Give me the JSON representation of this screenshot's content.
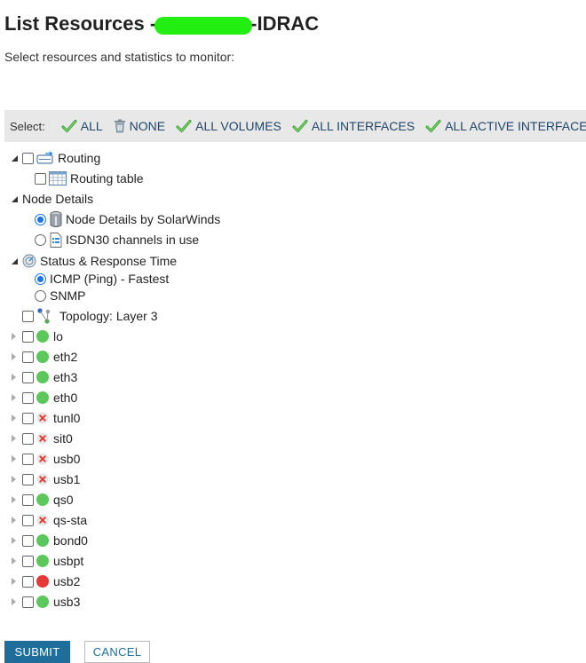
{
  "header": {
    "title_prefix": "List Resources -",
    "title_suffix": "-IDRAC",
    "subtitle": "Select resources and statistics to monitor:"
  },
  "select_bar": {
    "label": "Select:",
    "all": "ALL",
    "none": "NONE",
    "all_volumes": "ALL VOLUMES",
    "all_interfaces": "ALL INTERFACES",
    "all_active_interfaces": "ALL ACTIVE INTERFACES"
  },
  "tree": {
    "routing": "Routing",
    "routing_table": "Routing table",
    "node_details": "Node Details",
    "node_details_solarwinds": "Node Details by SolarWinds",
    "isdn30": "ISDN30 channels in use",
    "status_response": "Status & Response Time",
    "icmp": "ICMP (Ping) - Fastest",
    "snmp": "SNMP",
    "topology": "Topology: Layer 3"
  },
  "interfaces": [
    {
      "name": "lo",
      "status": "up"
    },
    {
      "name": "eth2",
      "status": "up"
    },
    {
      "name": "eth3",
      "status": "up"
    },
    {
      "name": "eth0",
      "status": "up"
    },
    {
      "name": "tunl0",
      "status": "unknown"
    },
    {
      "name": "sit0",
      "status": "unknown"
    },
    {
      "name": "usb0",
      "status": "unknown"
    },
    {
      "name": "usb1",
      "status": "unknown"
    },
    {
      "name": "qs0",
      "status": "up"
    },
    {
      "name": "qs-sta",
      "status": "unknown"
    },
    {
      "name": "bond0",
      "status": "up"
    },
    {
      "name": "usbpt",
      "status": "up"
    },
    {
      "name": "usb2",
      "status": "down"
    },
    {
      "name": "usb3",
      "status": "up"
    }
  ],
  "colors": {
    "up": "#5cc85c",
    "down": "#e53935",
    "check": "#3aa53a",
    "accent": "#1e6d9b"
  },
  "buttons": {
    "submit": "SUBMIT",
    "cancel": "CANCEL"
  }
}
